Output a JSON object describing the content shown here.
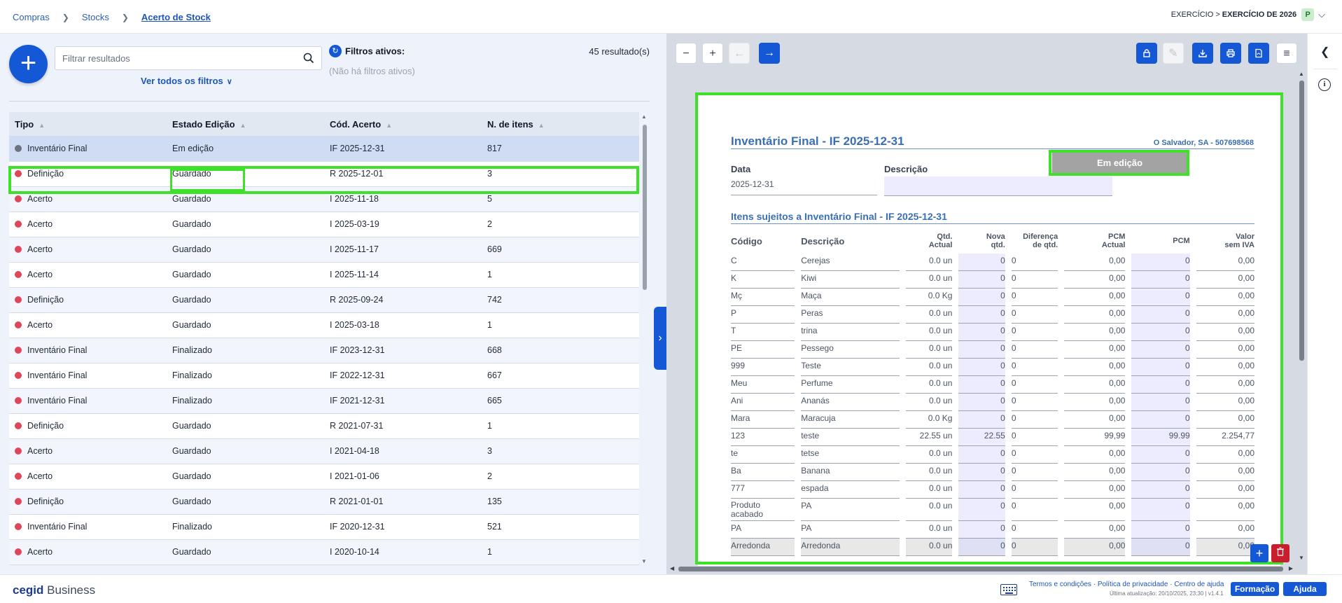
{
  "breadcrumb": [
    "Compras",
    "Stocks",
    "Acerto de Stock"
  ],
  "exercise": {
    "prefix": "EXERCÍCIO >",
    "value": "EXERCÍCIO DE 2026",
    "badge": "P"
  },
  "left": {
    "search_placeholder": "Filtrar resultados",
    "see_all_filters": "Ver todos os filtros",
    "active_filters_title": "Filtros ativos:",
    "no_active_filters": "(Não há filtros ativos)",
    "results": "45 resultado(s)",
    "columns": [
      "Tipo",
      "Estado Edição",
      "Cód. Acerto",
      "N. de itens"
    ],
    "rows": [
      {
        "tipo": "Inventário Final",
        "estado": "Em edição",
        "cod": "IF 2025-12-31",
        "n": "817",
        "dot": "grey"
      },
      {
        "tipo": "Definição",
        "estado": "Guardado",
        "cod": "R 2025-12-01",
        "n": "3",
        "dot": "red"
      },
      {
        "tipo": "Acerto",
        "estado": "Guardado",
        "cod": "I 2025-11-18",
        "n": "5",
        "dot": "red"
      },
      {
        "tipo": "Acerto",
        "estado": "Guardado",
        "cod": "I 2025-03-19",
        "n": "2",
        "dot": "red"
      },
      {
        "tipo": "Acerto",
        "estado": "Guardado",
        "cod": "I 2025-11-17",
        "n": "669",
        "dot": "red"
      },
      {
        "tipo": "Acerto",
        "estado": "Guardado",
        "cod": "I 2025-11-14",
        "n": "1",
        "dot": "red"
      },
      {
        "tipo": "Definição",
        "estado": "Guardado",
        "cod": "R 2025-09-24",
        "n": "742",
        "dot": "red"
      },
      {
        "tipo": "Acerto",
        "estado": "Guardado",
        "cod": "I 2025-03-18",
        "n": "1",
        "dot": "red"
      },
      {
        "tipo": "Inventário Final",
        "estado": "Finalizado",
        "cod": "IF 2023-12-31",
        "n": "668",
        "dot": "red"
      },
      {
        "tipo": "Inventário Final",
        "estado": "Finalizado",
        "cod": "IF 2022-12-31",
        "n": "667",
        "dot": "red"
      },
      {
        "tipo": "Inventário Final",
        "estado": "Finalizado",
        "cod": "IF 2021-12-31",
        "n": "665",
        "dot": "red"
      },
      {
        "tipo": "Definição",
        "estado": "Guardado",
        "cod": "R 2021-07-31",
        "n": "1",
        "dot": "red"
      },
      {
        "tipo": "Acerto",
        "estado": "Guardado",
        "cod": "I 2021-04-18",
        "n": "3",
        "dot": "red"
      },
      {
        "tipo": "Acerto",
        "estado": "Guardado",
        "cod": "I 2021-01-06",
        "n": "2",
        "dot": "red"
      },
      {
        "tipo": "Definição",
        "estado": "Guardado",
        "cod": "R 2021-01-01",
        "n": "135",
        "dot": "red"
      },
      {
        "tipo": "Inventário Final",
        "estado": "Finalizado",
        "cod": "IF 2020-12-31",
        "n": "521",
        "dot": "red"
      },
      {
        "tipo": "Acerto",
        "estado": "Guardado",
        "cod": "I 2020-10-14",
        "n": "1",
        "dot": "red"
      }
    ]
  },
  "doc": {
    "title": "Inventário Final - IF 2025-12-31",
    "company": "O Salvador, SA - 507698568",
    "status": "Em edição",
    "data_label": "Data",
    "data_value": "2025-12-31",
    "desc_label": "Descrição",
    "section_title": "Itens sujeitos a Inventário Final - IF 2025-12-31",
    "columns": [
      {
        "l1": "Código",
        "l2": ""
      },
      {
        "l1": "Descrição",
        "l2": ""
      },
      {
        "l1": "Qtd.",
        "l2": "Actual"
      },
      {
        "l1": "Nova",
        "l2": "qtd."
      },
      {
        "l1": "Diferença",
        "l2": "de qtd."
      },
      {
        "l1": "PCM",
        "l2": "Actual"
      },
      {
        "l1": "PCM",
        "l2": ""
      },
      {
        "l1": "Valor",
        "l2": "sem IVA"
      }
    ],
    "items": [
      [
        "C",
        "Cerejas",
        "0.0 un",
        "0",
        "0",
        "0,00",
        "0",
        "0,00"
      ],
      [
        "K",
        "Kiwi",
        "0.0 un",
        "0",
        "0",
        "0,00",
        "0",
        "0,00"
      ],
      [
        "Mç",
        "Maça",
        "0.0 Kg",
        "0",
        "0",
        "0,00",
        "0",
        "0,00"
      ],
      [
        "P",
        "Peras",
        "0.0 un",
        "0",
        "0",
        "0,00",
        "0",
        "0,00"
      ],
      [
        "T",
        "trina",
        "0.0 un",
        "0",
        "0",
        "0,00",
        "0",
        "0,00"
      ],
      [
        "PE",
        "Pessego",
        "0.0 un",
        "0",
        "0",
        "0,00",
        "0",
        "0,00"
      ],
      [
        "999",
        "Teste",
        "0.0 un",
        "0",
        "0",
        "0,00",
        "0",
        "0,00"
      ],
      [
        "Meu",
        "Perfume",
        "0.0 un",
        "0",
        "0",
        "0,00",
        "0",
        "0,00"
      ],
      [
        "Ani",
        "Ananás",
        "0.0 un",
        "0",
        "0",
        "0,00",
        "0",
        "0,00"
      ],
      [
        "Mara",
        "Maracuja",
        "0.0 Kg",
        "0",
        "0",
        "0,00",
        "0",
        "0,00"
      ],
      [
        "123",
        "teste",
        "22.55 un",
        "22.55",
        "0",
        "99,99",
        "99.99",
        "2.254,77"
      ],
      [
        "te",
        "tetse",
        "0.0 un",
        "0",
        "0",
        "0,00",
        "0",
        "0,00"
      ],
      [
        "Ba",
        "Banana",
        "0.0 un",
        "0",
        "0",
        "0,00",
        "0",
        "0,00"
      ],
      [
        "777",
        "espada",
        "0.0 un",
        "0",
        "0",
        "0,00",
        "0",
        "0,00"
      ],
      [
        "Produto acabado",
        "PA",
        "0.0 un",
        "0",
        "0",
        "0,00",
        "0",
        "0,00"
      ],
      [
        "PA",
        "PA",
        "0.0 un",
        "0",
        "0",
        "0,00",
        "0",
        "0,00"
      ],
      [
        "Arredonda",
        "Arredonda",
        "0.0 un",
        "0",
        "0",
        "0,00",
        "0",
        "0,00"
      ]
    ]
  },
  "footer": {
    "brand_bold": "cegid",
    "brand_rest": "Business",
    "links": "Termos e condições · Política de privacidade · Centro de ajuda",
    "update": "Última atualização: 20/10/2025, 23:30 | v1.4.1",
    "formacao": "Formação",
    "ajuda": "Ajuda"
  },
  "colors": {
    "primary": "#1558d6",
    "highlight": "#3fe02a",
    "danger": "#c81e2e",
    "status_red": "#e0455a"
  }
}
